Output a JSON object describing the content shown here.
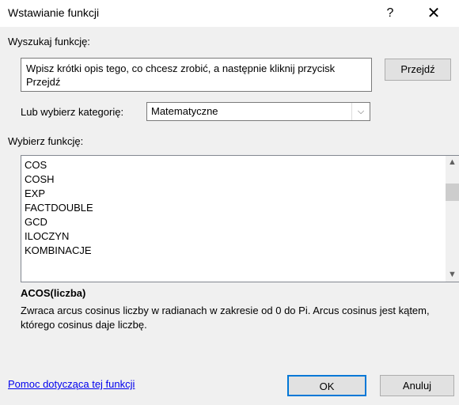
{
  "window": {
    "title": "Wstawianie funkcji",
    "help_glyph": "?",
    "close_glyph": "✕"
  },
  "search": {
    "label": "Wyszukaj funkcję:",
    "value": "Wpisz krótki opis tego, co chcesz zrobić, a następnie kliknij przycisk Przejdź",
    "go_button": "Przejdź"
  },
  "category": {
    "label": "Lub wybierz kategorię:",
    "selected": "Matematyczne"
  },
  "function_list": {
    "label": "Wybierz funkcję:",
    "items": [
      "COS",
      "COSH",
      "EXP",
      "FACTDOUBLE",
      "GCD",
      "ILOCZYN",
      "KOMBINACJE"
    ]
  },
  "details": {
    "signature": "ACOS(liczba)",
    "description": "Zwraca arcus cosinus liczby w radianach w zakresie od 0 do Pi. Arcus cosinus jest kątem, którego cosinus daje liczbę."
  },
  "footer": {
    "help_link": "Pomoc dotycząca tej funkcji",
    "ok_label": "OK",
    "cancel_label": "Anuluj"
  }
}
